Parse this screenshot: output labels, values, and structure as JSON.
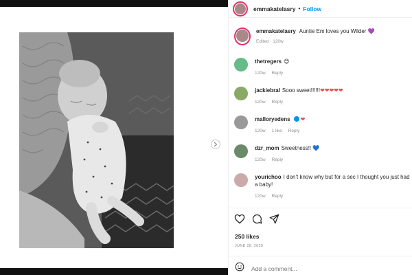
{
  "post": {
    "username": "emmakatelasry",
    "follow_label": "Follow",
    "separator": "•",
    "caption": "Auntie Em loves you Wilder",
    "caption_emoji": "💜",
    "caption_meta": "Edited · 120w",
    "likes": "250 likes",
    "date": "JUNE 28, 2020",
    "add_comment_placeholder": "Add a comment..."
  },
  "comments": [
    {
      "user": "thetregers",
      "text": "",
      "emoji": "😍",
      "age": "120w",
      "likes": "",
      "reply": "Reply",
      "verified": false
    },
    {
      "user": "jackiebral",
      "text": "Sooo sweet!!!!!!",
      "emoji": "❤❤❤❤❤",
      "age": "120w",
      "likes": "",
      "reply": "Reply",
      "verified": false
    },
    {
      "user": "malloryedens",
      "text": "",
      "emoji": "❤",
      "age": "120w",
      "likes": "1 like",
      "reply": "Reply",
      "verified": true
    },
    {
      "user": "dzr_mom",
      "text": "Sweetness!!",
      "emoji": "💙",
      "age": "120w",
      "likes": "",
      "reply": "Reply",
      "verified": false
    },
    {
      "user": "yourichoo",
      "text": "I don't know why but for a sec I thought you just had a baby!",
      "emoji": "",
      "age": "120w",
      "likes": "",
      "reply": "Reply",
      "verified": false
    }
  ],
  "colors": {
    "accent": "#0095f6",
    "heart": "#ed4956",
    "ring": "#e1306c",
    "muted": "#8e8e8e"
  }
}
